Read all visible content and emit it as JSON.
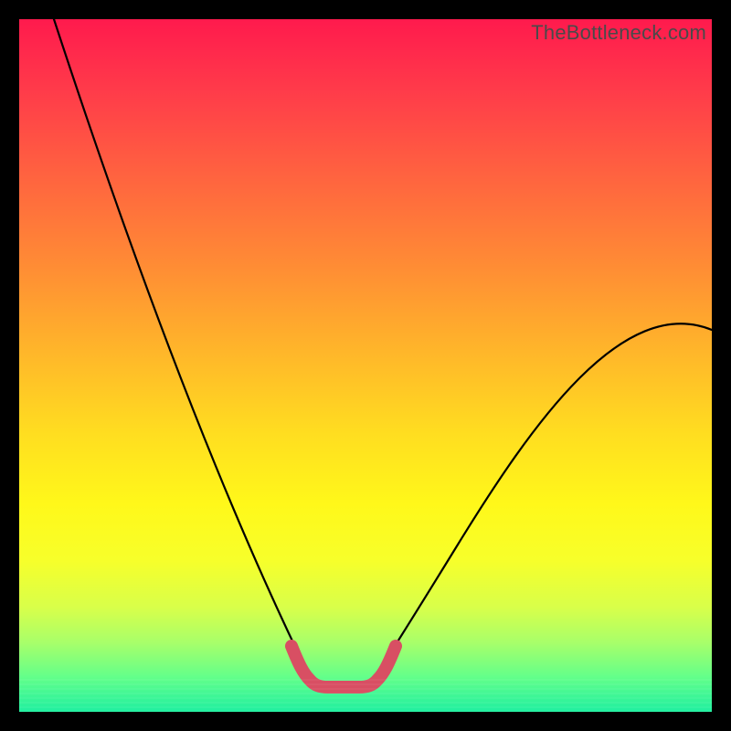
{
  "watermark": "TheBottleneck.com",
  "chart_data": {
    "type": "line",
    "title": "",
    "xlabel": "",
    "ylabel": "",
    "x": [
      0.0,
      0.05,
      0.1,
      0.15,
      0.2,
      0.25,
      0.3,
      0.35,
      0.4,
      0.425,
      0.45,
      0.475,
      0.5,
      0.55,
      0.6,
      0.65,
      0.7,
      0.75,
      0.8,
      0.85,
      0.9,
      0.95,
      1.0
    ],
    "series": [
      {
        "name": "bottleneck-curve",
        "values": [
          1.0,
          0.89,
          0.78,
          0.67,
          0.55,
          0.44,
          0.33,
          0.22,
          0.11,
          0.05,
          0.02,
          0.02,
          0.02,
          0.08,
          0.16,
          0.24,
          0.32,
          0.4,
          0.48,
          0.55,
          0.61,
          0.66,
          0.55
        ]
      }
    ],
    "xlim": [
      0,
      1
    ],
    "ylim": [
      0,
      1
    ],
    "flat_bottom_range": [
      0.42,
      0.5
    ],
    "note": "Values estimated from pixel positions; axes unlabeled in source image."
  }
}
